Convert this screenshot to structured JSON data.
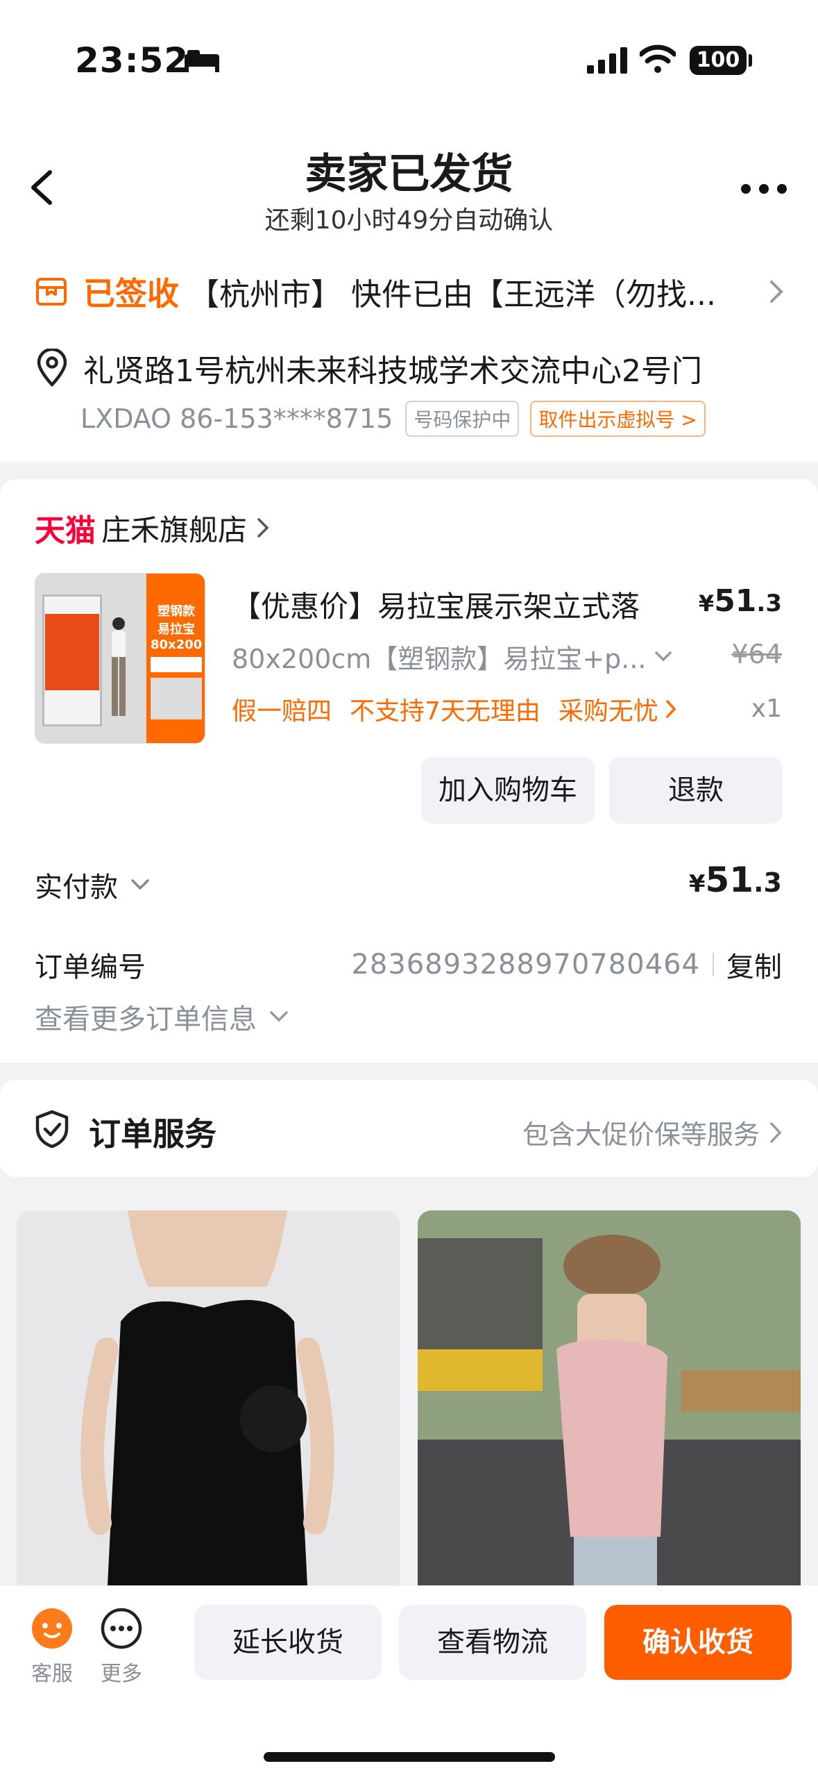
{
  "status_bar": {
    "time": "23:52",
    "battery": "100"
  },
  "header": {
    "title": "卖家已发货",
    "subtitle": "还剩10小时49分自动确认"
  },
  "logistics": {
    "status": "已签收",
    "text": "【杭州市】 快件已由【王远洋（勿找..."
  },
  "address": {
    "line": "礼贤路1号杭州未来科技城学术交流中心2号门",
    "contact": "LXDAO 86-153****8715",
    "privacy_tag": "号码保护中",
    "virtual_tag": "取件出示虚拟号 >"
  },
  "shop": {
    "platform": "天猫",
    "name": "庄禾旗舰店"
  },
  "product": {
    "title": "【优惠价】易拉宝展示架立式落",
    "price_currency": "¥",
    "price_main": "51",
    "price_decimal": ".3",
    "sku": "80x200cm【塑钢款】易拉宝+p...",
    "original_price": "¥64",
    "promo_tags": [
      "假一赔四",
      "不支持7天无理由",
      "采购无忧"
    ],
    "quantity": "x1",
    "thumb_text": "塑钢款 易拉宝 80x200"
  },
  "actions": {
    "add_cart": "加入购物车",
    "refund": "退款"
  },
  "payment": {
    "label": "实付款",
    "currency": "¥",
    "main": "51",
    "decimal": ".3"
  },
  "order": {
    "no_label": "订单编号",
    "no_value": "2836893288970780464",
    "copy": "复制",
    "more": "查看更多订单信息"
  },
  "service": {
    "title": "订单服务",
    "right": "包含大促价保等服务"
  },
  "bottom": {
    "service": "客服",
    "more": "更多",
    "extend": "延长收货",
    "logistics": "查看物流",
    "confirm": "确认收货"
  },
  "colors": {
    "accent": "#ff6a00",
    "tmall": "#ff0036",
    "confirm": "#ff5e00"
  }
}
